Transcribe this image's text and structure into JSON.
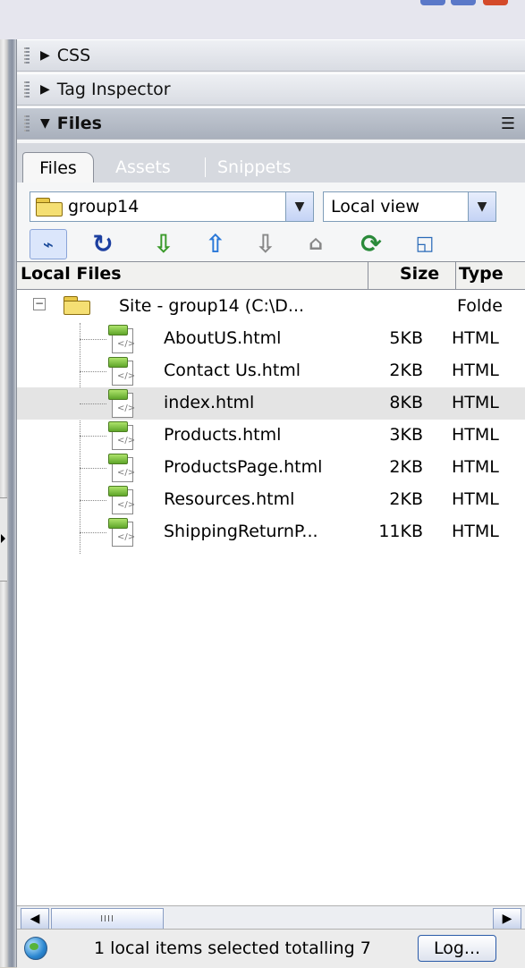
{
  "panels": {
    "css": "CSS",
    "tag_inspector": "Tag Inspector",
    "files": "Files"
  },
  "tabs": [
    "Files",
    "Assets",
    "Snippets"
  ],
  "toolbar": {
    "site_select": "group14",
    "view_select": "Local view",
    "icons": [
      "connect-icon",
      "refresh-icon",
      "get-files-icon",
      "put-files-icon",
      "check-out-icon",
      "check-in-icon",
      "synchronize-icon",
      "expand-icon"
    ]
  },
  "columns": {
    "local_files": "Local Files",
    "size": "Size",
    "type": "Type"
  },
  "tree": {
    "root": {
      "name": "Site - group14 (C:\\D...",
      "type": "Folde"
    },
    "files": [
      {
        "name": "AboutUS.html",
        "size": "5KB",
        "type": "HTML"
      },
      {
        "name": "Contact Us.html",
        "size": "2KB",
        "type": "HTML"
      },
      {
        "name": "index.html",
        "size": "8KB",
        "type": "HTML",
        "selected": true
      },
      {
        "name": "Products.html",
        "size": "3KB",
        "type": "HTML"
      },
      {
        "name": "ProductsPage.html",
        "size": "2KB",
        "type": "HTML"
      },
      {
        "name": "Resources.html",
        "size": "2KB",
        "type": "HTML"
      },
      {
        "name": "ShippingReturnP...",
        "size": "11KB",
        "type": "HTML"
      }
    ]
  },
  "status": {
    "text": "1 local items selected totalling 7",
    "log_button": "Log..."
  },
  "colors": {
    "panel_header": "#d9dce3",
    "panel_header_active": "#a9b0bc",
    "selection_row": "#e4e4e4",
    "dropdown_border": "#7f9db9"
  }
}
